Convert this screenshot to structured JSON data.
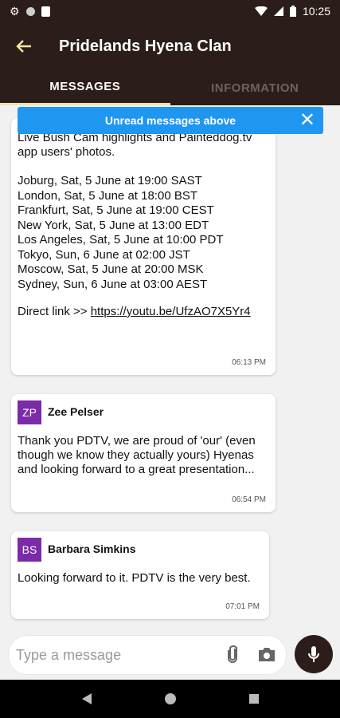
{
  "status_bar": {
    "time": "10:25",
    "icons": [
      "gear-icon",
      "circle-icon",
      "sd-card-icon",
      "wifi-icon",
      "battery-icon"
    ]
  },
  "header": {
    "title": "Pridelands Hyena Clan",
    "back_icon": "arrow-back-icon"
  },
  "tabs": [
    {
      "label": "MESSAGES",
      "active": true
    },
    {
      "label": "INFORMATION",
      "active": false
    }
  ],
  "banner": {
    "text": "Unread messages above",
    "close_icon": "close-icon",
    "color": "#1f97f0"
  },
  "messages": [
    {
      "text": "of Pridelands Conservancy! Not to forget the Live Bush Cam highlights and Painteddog.tv app users' photos.",
      "schedule": [
        "Joburg,    Sat, 5 June at 19:00 SAST",
        "London,       Sat, 5 June at 18:00 BST",
        "Frankfurt,   Sat, 5 June at 19:00 CEST",
        "New York,     Sat, 5 June at 13:00 EDT",
        "Los Angeles,    Sat, 5 June at 10:00 PDT",
        "Tokyo,        Sun, 6 June at 02:00 JST",
        "Moscow,      Sat, 5 June at 20:00 MSK",
        "Sydney,     Sun, 6 June at 03:00 AEST"
      ],
      "direct_label": "Direct link >> ",
      "direct_link": "https://youtu.be/UfzAO7X5Yr4",
      "time": "06:13 PM"
    },
    {
      "initials": "ZP",
      "sender": "Zee Pelser",
      "text": "Thank you PDTV, we are proud of 'our' (even though we know they actually yours) Hyenas and looking forward to a great presentation...",
      "time": "06:54 PM"
    },
    {
      "initials": "BS",
      "sender": "Barbara Simkins",
      "text": "Looking forward to it. PDTV is the very best.",
      "time": "07:01 PM"
    }
  ],
  "composer": {
    "placeholder": "Type a message",
    "attach_icon": "paperclip-icon",
    "camera_icon": "camera-icon",
    "mic_icon": "microphone-icon"
  },
  "colors": {
    "primary": "#2b1d19",
    "accent": "#f0e3b3",
    "avatar": "#7b2aa8"
  }
}
